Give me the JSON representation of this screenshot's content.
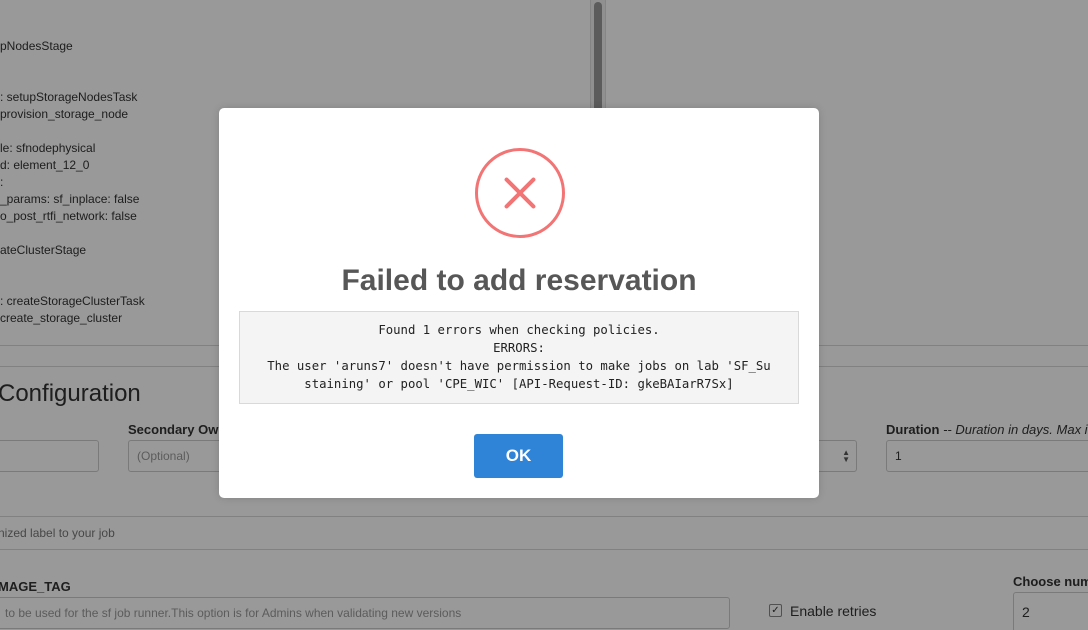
{
  "yaml": {
    "lines": [
      "pNodesStage",
      ": setupStorageNodesTask",
      "provision_storage_node",
      "le: sfnodephysical",
      "d: element_12_0",
      ":",
      "_params: sf_inplace: false",
      "o_post_rtfi_network: false",
      "ateClusterStage",
      ": createStorageClusterTask",
      "create_storage_cluster"
    ]
  },
  "config": {
    "title": "Configuration",
    "secondary_owner_label": "Secondary Ow",
    "secondary_owner_placeholder": "(Optional)",
    "duration_label": "Duration",
    "duration_help": "-- Duration in days. Max i",
    "duration_value": "1",
    "label_help": "nized label to your job",
    "image_tag_label": "MAGE_TAG",
    "image_tag_placeholder": "to be used for the sf job runner.This option is for Admins when validating new versions",
    "enable_retries_label": "Enable retries",
    "enable_retries_checked": "✓",
    "choose_num_label": "Choose num",
    "choose_num_value": "2"
  },
  "modal": {
    "icon": "error-x-icon",
    "title": "Failed to add reservation",
    "message_lines": [
      "Found 1 errors when checking policies.",
      "ERRORS:",
      "The user 'aruns7' doesn't have permission to make jobs on lab 'SF_Su",
      "staining' or pool 'CPE_WIC' [API-Request-ID: gkeBAIarR7Sx]"
    ],
    "ok_label": "OK",
    "accent_color": "#f27474",
    "button_color": "#2f84d8"
  }
}
